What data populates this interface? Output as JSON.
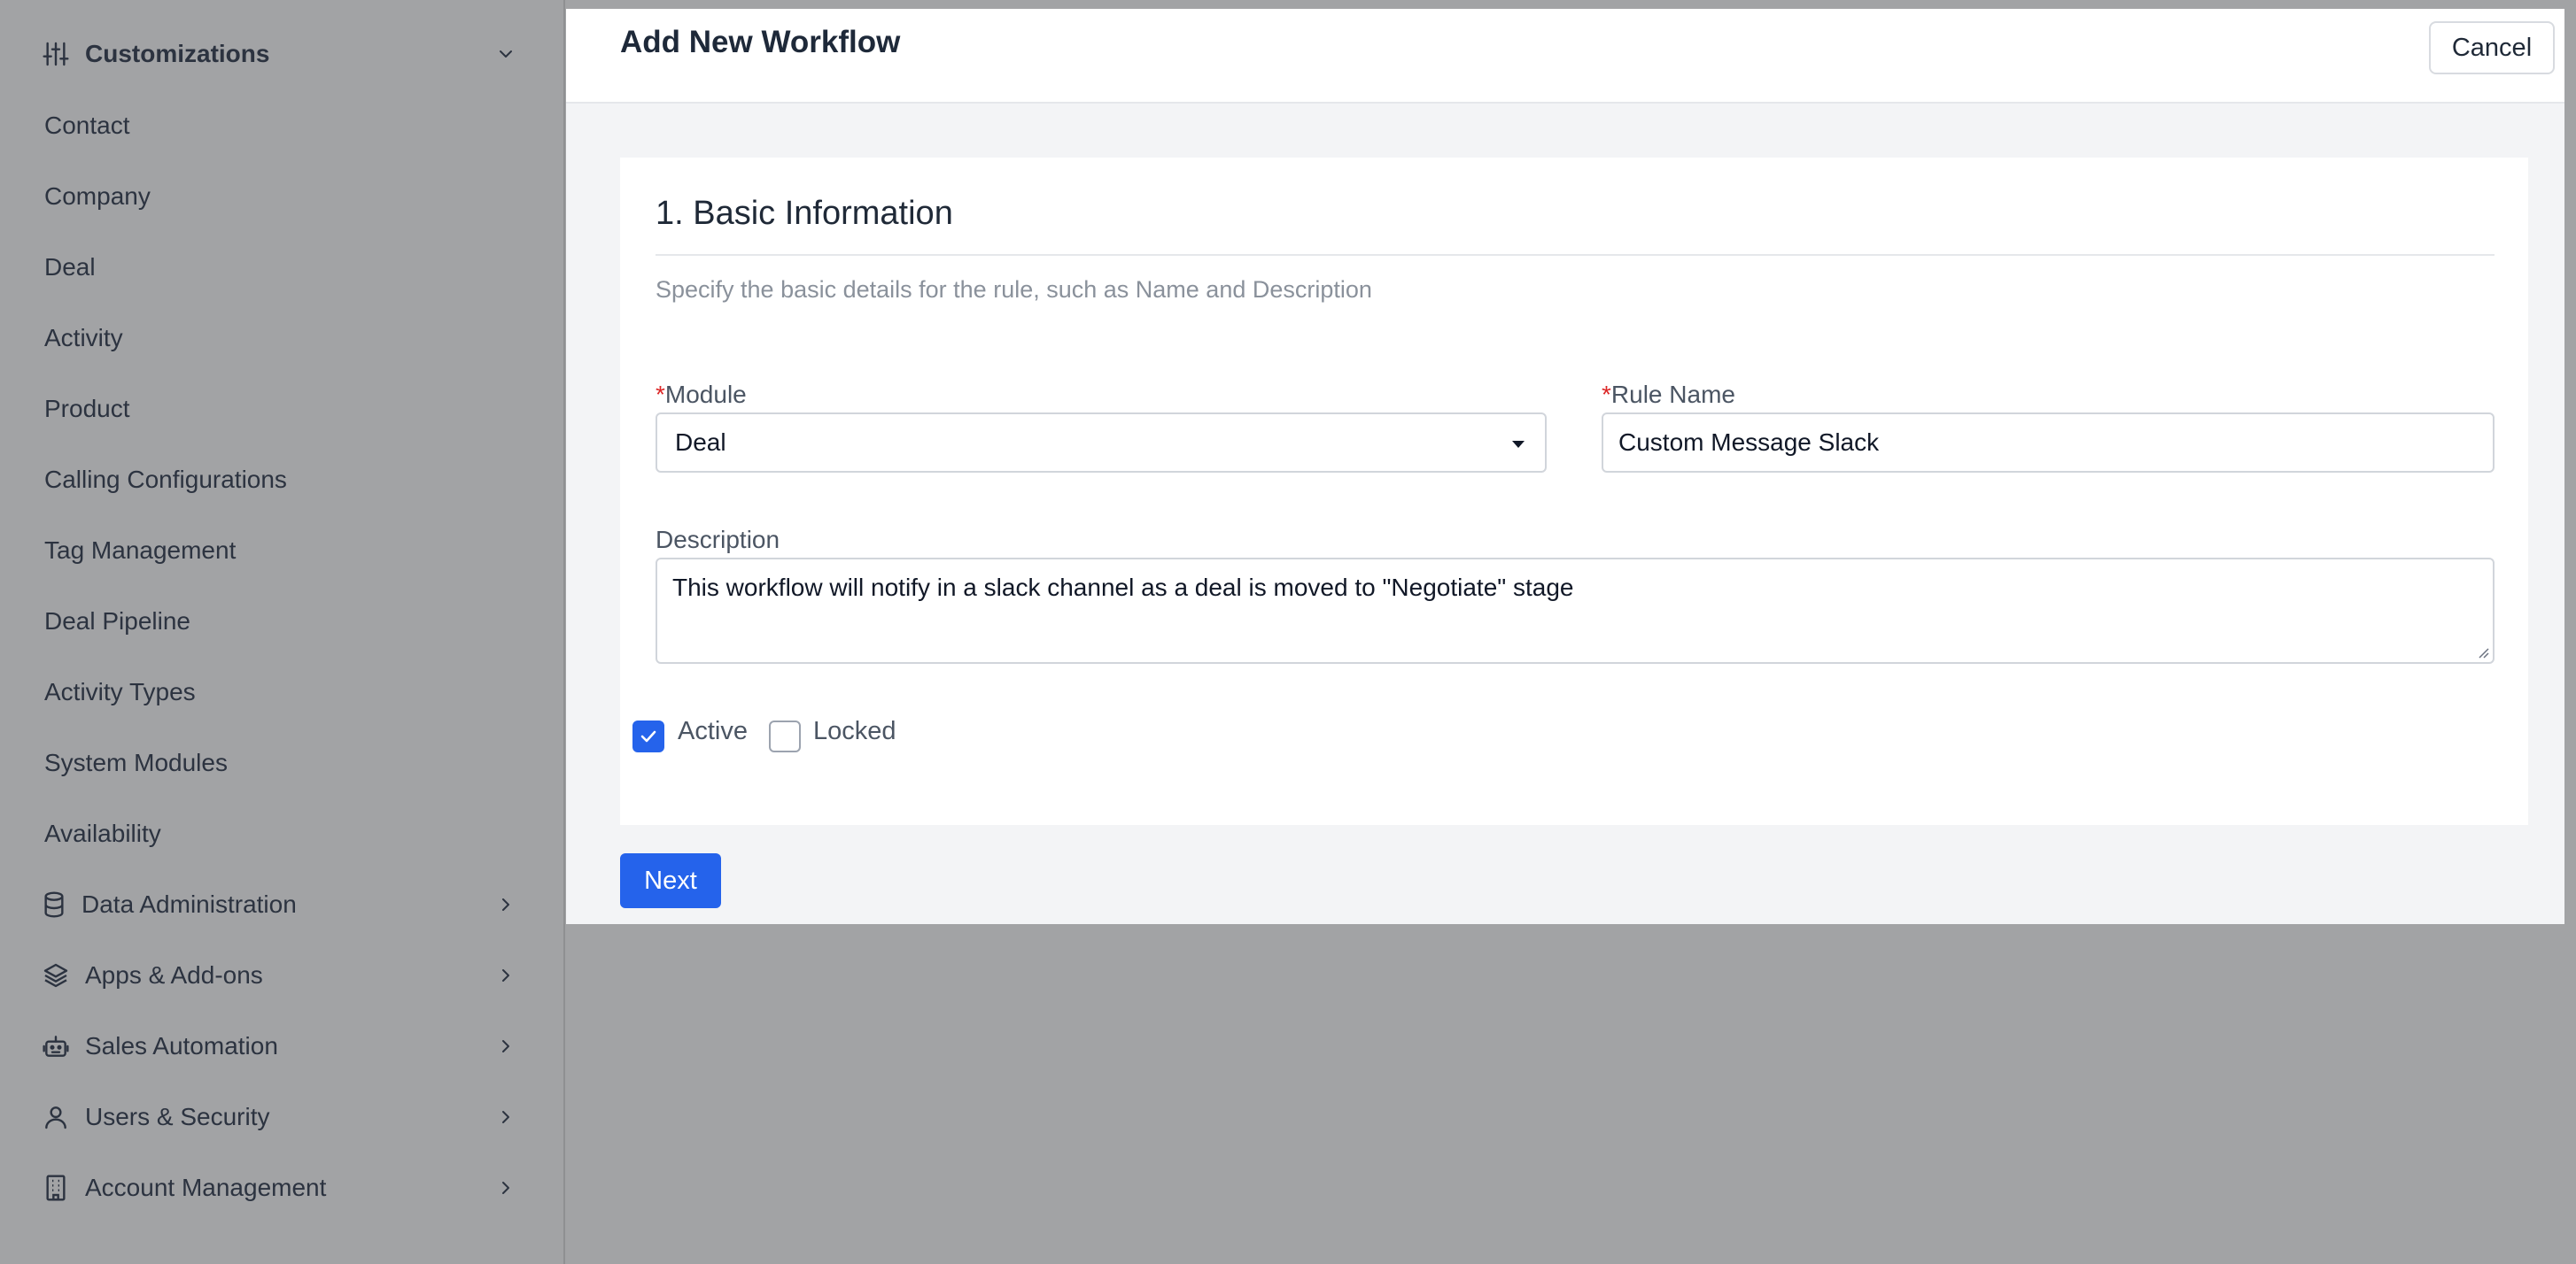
{
  "colors": {
    "overlay": "#a2a3a5",
    "accent": "#2563eb",
    "required": "#dc2626"
  },
  "sidebar": {
    "header": {
      "label": "Customizations",
      "icon": "sliders-icon",
      "expanded": true
    },
    "sub_items": [
      {
        "label": "Contact"
      },
      {
        "label": "Company"
      },
      {
        "label": "Deal"
      },
      {
        "label": "Activity"
      },
      {
        "label": "Product"
      },
      {
        "label": "Calling Configurations"
      },
      {
        "label": "Tag Management"
      },
      {
        "label": "Deal Pipeline"
      },
      {
        "label": "Activity Types"
      },
      {
        "label": "System Modules"
      },
      {
        "label": "Availability"
      }
    ],
    "sections": [
      {
        "label": "Data Administration",
        "icon": "database-icon"
      },
      {
        "label": "Apps & Add-ons",
        "icon": "layers-icon"
      },
      {
        "label": "Sales Automation",
        "icon": "robot-icon"
      },
      {
        "label": "Users & Security",
        "icon": "user-icon"
      },
      {
        "label": "Account Management",
        "icon": "building-icon"
      }
    ]
  },
  "modal": {
    "title": "Add New Workflow",
    "cancel_label": "Cancel",
    "next_label": "Next",
    "section": {
      "title": "1. Basic Information",
      "subtitle": "Specify the basic details for the rule, such as Name and Description"
    },
    "fields": {
      "module": {
        "required_mark": "*",
        "label": "Module",
        "value": "Deal"
      },
      "rule_name": {
        "required_mark": "*",
        "label": "Rule Name",
        "value": "Custom Message Slack"
      },
      "description": {
        "label": "Description",
        "value": "This workflow will notify in a slack channel as a deal is moved to \"Negotiate\" stage"
      }
    },
    "checkboxes": {
      "active": {
        "label": "Active",
        "checked": true
      },
      "locked": {
        "label": "Locked",
        "checked": false
      }
    }
  }
}
